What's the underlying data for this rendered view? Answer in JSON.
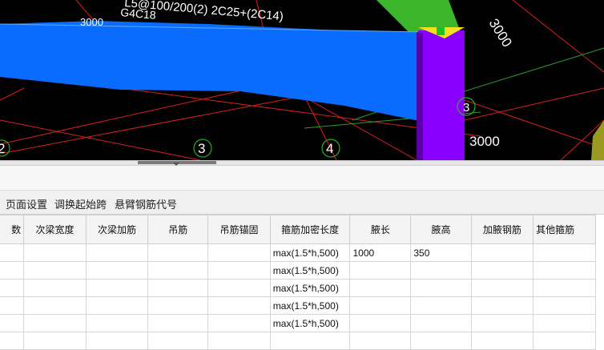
{
  "viewport": {
    "beam_label_1": "L5@100/200(2) 2C25+(2C14)",
    "beam_label_2": "G4C18",
    "partial_dim": "3000",
    "column_dim_rotated": "3000",
    "column_dim": "3000",
    "axis_markers": [
      "2",
      "3",
      "4"
    ],
    "partial_marker": "3",
    "colors": {
      "beam": "#0a6cff",
      "column": "#8a00ff",
      "grid_lines": "#d42020",
      "green_beam": "#3bb52a"
    }
  },
  "toolbar": {
    "items": [
      "页面设置",
      "调换起始跨",
      "悬臂钢筋代号"
    ]
  },
  "table": {
    "headers": [
      "数",
      "次梁宽度",
      "次梁加筋",
      "吊筋",
      "吊筋锚固",
      "箍筋加密长度",
      "腋长",
      "腋高",
      "加腋钢筋",
      "其他箍筋"
    ],
    "rows": [
      [
        "",
        "",
        "",
        "",
        "",
        "max(1.5*h,500)",
        "1000",
        "350",
        "",
        ""
      ],
      [
        "",
        "",
        "",
        "",
        "",
        "max(1.5*h,500)",
        "",
        "",
        "",
        ""
      ],
      [
        "",
        "",
        "",
        "",
        "",
        "max(1.5*h,500)",
        "",
        "",
        "",
        ""
      ],
      [
        "",
        "",
        "",
        "",
        "",
        "max(1.5*h,500)",
        "",
        "",
        "",
        ""
      ],
      [
        "",
        "",
        "",
        "",
        "",
        "max(1.5*h,500)",
        "",
        "",
        "",
        ""
      ],
      [
        "",
        "",
        "",
        "",
        "",
        "",
        "",
        "",
        "",
        ""
      ]
    ]
  }
}
